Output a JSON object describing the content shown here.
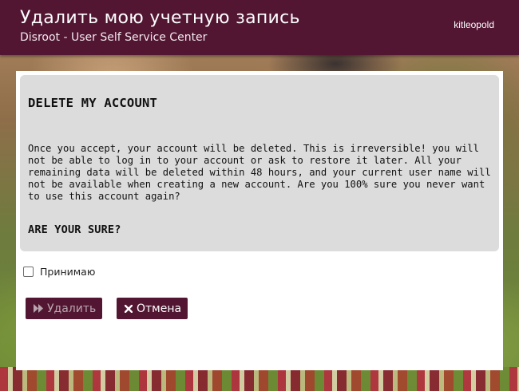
{
  "header": {
    "title": "Удалить мою учетную запись",
    "subtitle": "Disroot - User Self Service Center",
    "username": "kitleopold"
  },
  "warning": {
    "heading": "DELETE MY ACCOUNT",
    "body": "Once you accept, your account will be deleted. This is irreversible! you will not be able to log in to your account or ask to restore it later. All your remaining data will be deleted within 48 hours, and your current user name will not be available when creating a new account. Are you 100% sure you never want to use this account again?",
    "question": "ARE YOUR SURE?"
  },
  "form": {
    "accept_label": "Принимаю",
    "accept_checked": false,
    "delete_label": "Удалить",
    "delete_icon": "fast-forward-icon",
    "cancel_label": "Отмена",
    "cancel_icon": "close-icon"
  },
  "colors": {
    "brand": "#521633",
    "panel_background": "#ffffff",
    "warning_background": "#dcdcdc",
    "disabled_text": "#b9a5af"
  }
}
